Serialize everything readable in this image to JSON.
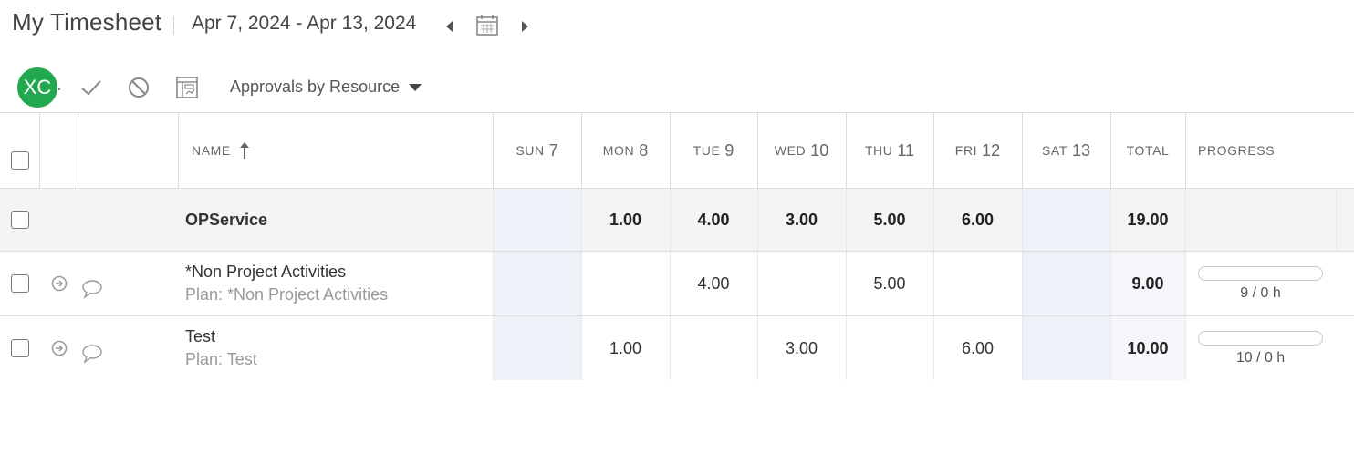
{
  "header": {
    "title": "My Timesheet",
    "date_range": "Apr 7, 2024 - Apr 13, 2024"
  },
  "toolbar": {
    "avatar_initials": "XC",
    "view_dropdown": "Approvals by Resource"
  },
  "columns": {
    "name": "NAME",
    "days": [
      {
        "label": "SUN",
        "num": "7"
      },
      {
        "label": "MON",
        "num": "8"
      },
      {
        "label": "TUE",
        "num": "9"
      },
      {
        "label": "WED",
        "num": "10"
      },
      {
        "label": "THU",
        "num": "11"
      },
      {
        "label": "FRI",
        "num": "12"
      },
      {
        "label": "SAT",
        "num": "13"
      }
    ],
    "total": "TOTAL",
    "progress": "PROGRESS"
  },
  "group": {
    "name": "OPService",
    "hours": [
      "",
      "1.00",
      "4.00",
      "3.00",
      "5.00",
      "6.00",
      ""
    ],
    "total": "19.00"
  },
  "tasks": [
    {
      "name": "*Non Project Activities",
      "plan": "Plan: *Non Project Activities",
      "hours": [
        "",
        "",
        "4.00",
        "",
        "5.00",
        "",
        ""
      ],
      "total": "9.00",
      "progress_label": "9 / 0 h",
      "progress_fraction": 0
    },
    {
      "name": "Test",
      "plan": "Plan: Test",
      "hours": [
        "",
        "1.00",
        "",
        "3.00",
        "",
        "6.00",
        ""
      ],
      "total": "10.00",
      "progress_label": "10 / 0 h",
      "progress_fraction": 0
    }
  ],
  "colors": {
    "avatar": "#22a94f",
    "weekend_shade": "#eef1f8"
  }
}
